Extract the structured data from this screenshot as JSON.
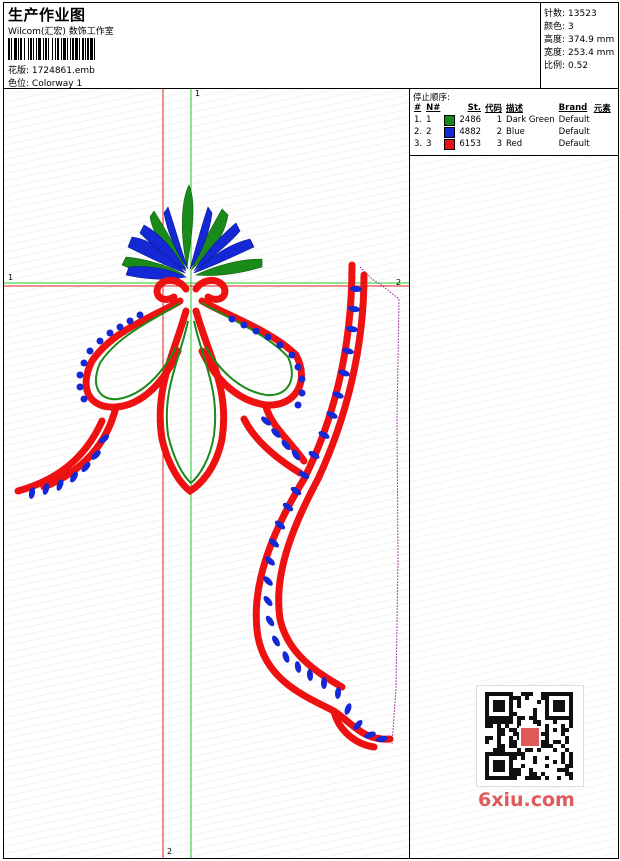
{
  "header": {
    "title": "生产作业图",
    "subtitle": "Wilcom(汇宏) 数饰工作室",
    "design_label": "花版:",
    "design_value": "1724861.emb",
    "colorway_label": "色位:",
    "colorway_value": "Colorway 1"
  },
  "stats": [
    {
      "label": "针数:",
      "value": "13523"
    },
    {
      "label": "颜色:",
      "value": "3"
    },
    {
      "label": "高度:",
      "value": "374.9 mm"
    },
    {
      "label": "宽度:",
      "value": "253.4 mm"
    },
    {
      "label": "比例:",
      "value": "0.52"
    }
  ],
  "stop_sequence": {
    "title": "停止顺序:",
    "columns": [
      "#",
      "N#",
      "St.",
      "代码",
      "描述",
      "Brand",
      "元素"
    ],
    "rows": [
      {
        "index": "1.",
        "n": "1",
        "color": "#138a18",
        "stitches": "2486",
        "code": "1",
        "desc": "Dark Green",
        "brand": "Default"
      },
      {
        "index": "2.",
        "n": "2",
        "color": "#1428d6",
        "stitches": "4882",
        "code": "2",
        "desc": "Blue",
        "brand": "Default"
      },
      {
        "index": "3.",
        "n": "3",
        "color": "#ee1111",
        "stitches": "6153",
        "code": "3",
        "desc": "Red",
        "brand": "Default"
      }
    ]
  },
  "guides": {
    "v_green_top": "1",
    "h_green_left": "1",
    "h_red_right": "2",
    "v_red_bottom": "2"
  },
  "watermark": "6xiu.com"
}
